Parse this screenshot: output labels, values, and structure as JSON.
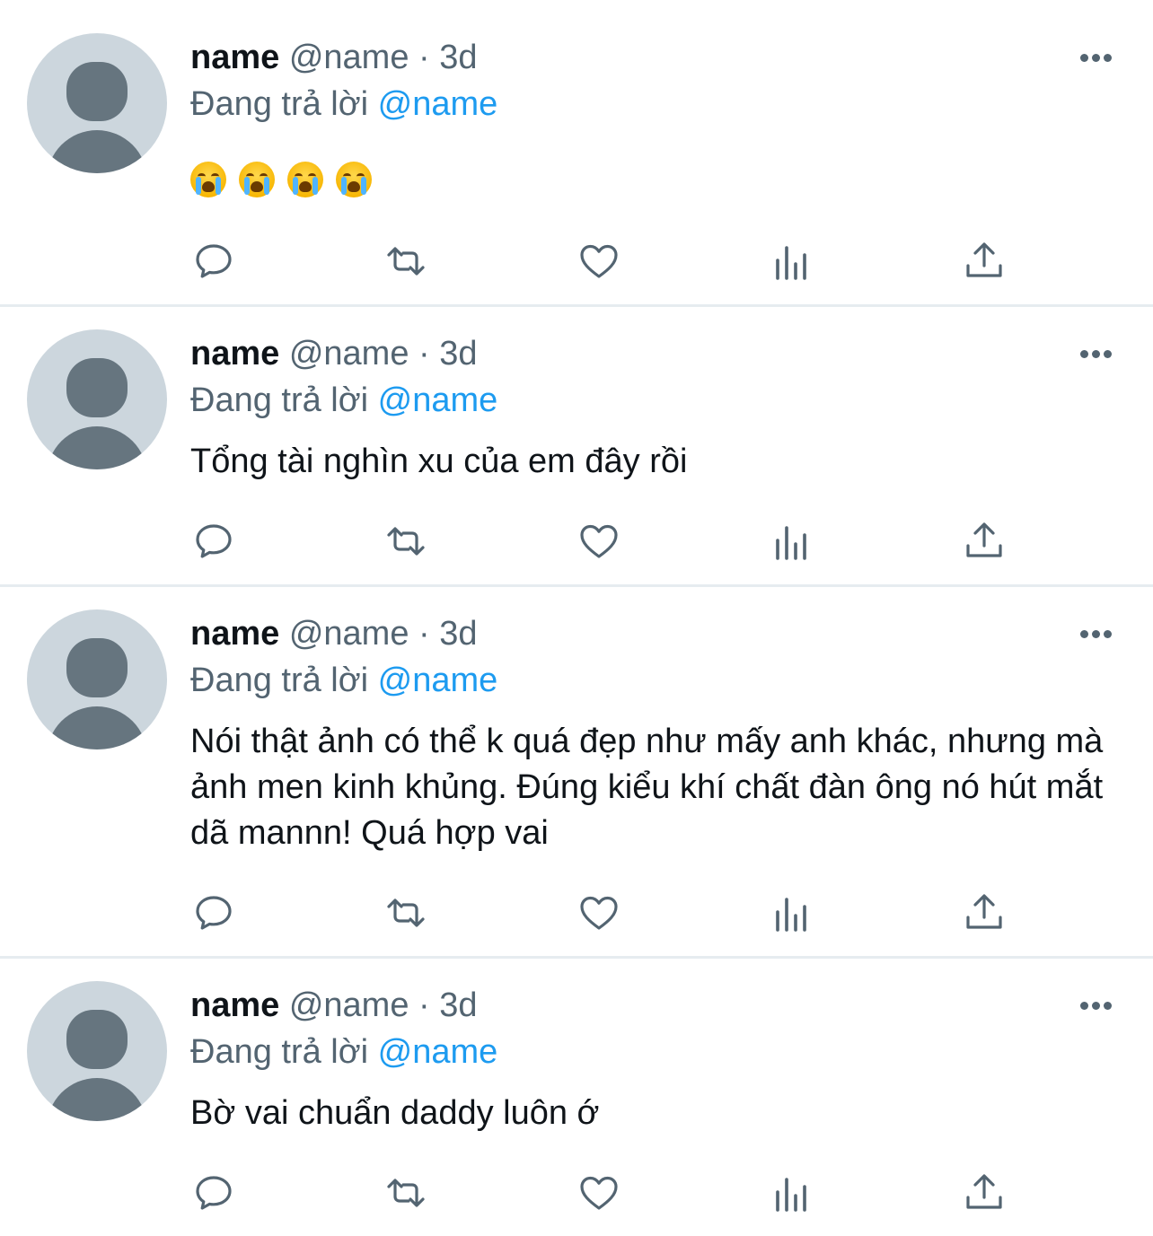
{
  "tweets": [
    {
      "display_name": "name",
      "handle": "@name",
      "separator": "·",
      "time": "3d",
      "reply_prefix": "Đang trả lời",
      "reply_mention": "@name",
      "emojis": [
        "loudly-crying-face",
        "loudly-crying-face",
        "loudly-crying-face",
        "loudly-crying-face"
      ],
      "text": ""
    },
    {
      "display_name": "name",
      "handle": "@name",
      "separator": "·",
      "time": "3d",
      "reply_prefix": "Đang trả lời",
      "reply_mention": "@name",
      "text": "Tổng tài nghìn xu của em đây rồi"
    },
    {
      "display_name": "name",
      "handle": "@name",
      "separator": "·",
      "time": "3d",
      "reply_prefix": "Đang trả lời",
      "reply_mention": "@name",
      "text": "Nói thật ảnh có thể k quá đẹp như mấy anh khác, nhưng mà ảnh men kinh khủng. Đúng kiểu khí chất đàn ông nó hút mắt dã mannn! Quá hợp vai"
    },
    {
      "display_name": "name",
      "handle": "@name",
      "separator": "·",
      "time": "3d",
      "reply_prefix": "Đang trả lời",
      "reply_mention": "@name",
      "text": "Bờ vai chuẩn daddy luôn ớ"
    }
  ],
  "action_icons": [
    "reply-icon",
    "retweet-icon",
    "like-icon",
    "analytics-icon",
    "share-icon"
  ],
  "colors": {
    "text_primary": "#0f1419",
    "text_secondary": "#536471",
    "mention": "#1d9bf0",
    "avatar_bg": "#ccd6dd",
    "avatar_fg": "#66757f",
    "divider": "#e6ecf0"
  }
}
